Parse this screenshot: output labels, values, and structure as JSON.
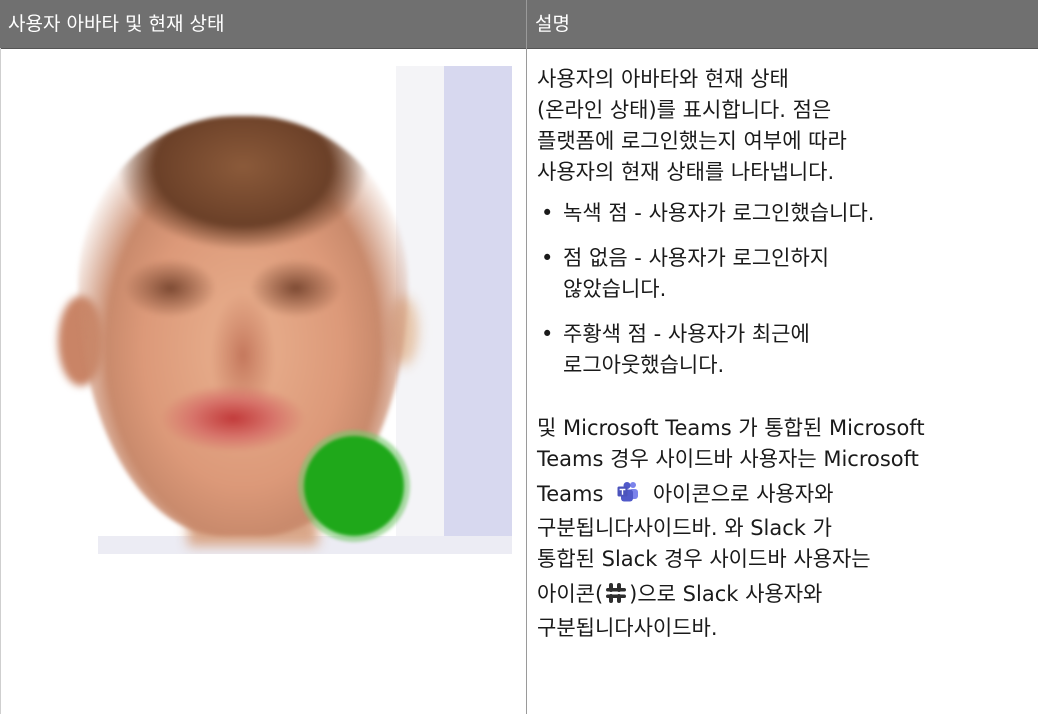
{
  "table": {
    "header_left": "사용자 아바타 및 현재 상태",
    "header_right": "설명"
  },
  "avatar": {
    "status_color": "#1fa81a",
    "status": "online"
  },
  "description": {
    "intro_lines": [
      "사용자의 아바타와 현재 상태",
      "(온라인 상태)를 표시합니다. 점은",
      "플랫폼에 로그인했는지 여부에 따라",
      "사용자의 현재 상태를 나타냅니다."
    ],
    "bullets": [
      {
        "mark": "•",
        "lines": [
          "녹색 점 - 사용자가 로그인했습니다."
        ]
      },
      {
        "mark": "•",
        "lines": [
          "점 없음 - 사용자가 로그인하지",
          "않았습니다."
        ]
      },
      {
        "mark": "•",
        "lines": [
          "주황색 점 - 사용자가 최근에",
          "로그아웃했습니다."
        ]
      }
    ],
    "teams": {
      "line1": "및 Microsoft Teams 가 통합된 Microsoft",
      "line2": "Teams 경우 사이드바 사용자는 Microsoft",
      "line3_before_icon": "Teams",
      "line3_after_icon": "아이콘으로 사용자와",
      "line4": "구분됩니다사이드바. 와 Slack 가",
      "line5": "통합된 Slack 경우 사이드바 사용자는",
      "icon_name": "microsoft-teams-icon"
    },
    "slack": {
      "line1_before_icon": "아이콘(",
      "line1_after_icon": ")으로 Slack 사용자와",
      "line2": "구분됩니다사이드바.",
      "icon_name": "slack-icon"
    }
  },
  "colors": {
    "header_bg": "#707070",
    "header_text": "#ffffff",
    "body_text": "#1a1a1a",
    "teams_purple": "#5059c9",
    "slack_dark": "#2d2d2d"
  }
}
